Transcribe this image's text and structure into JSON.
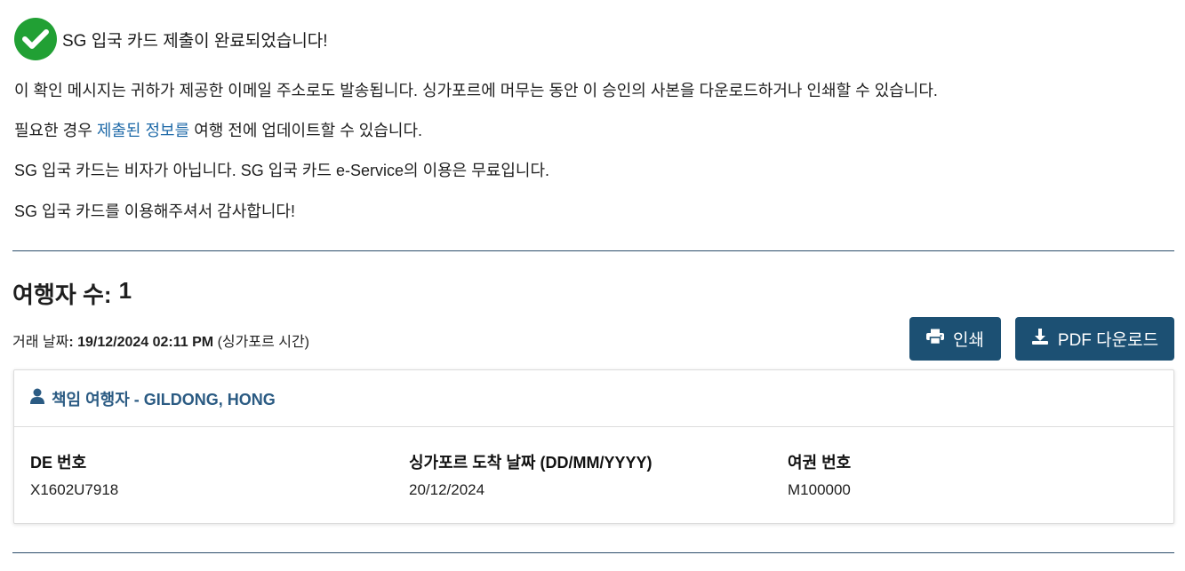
{
  "success": {
    "message": "SG 입국 카드 제출이 완료되었습니다!",
    "icon": "check-circle-icon",
    "color": "#21a034"
  },
  "info": {
    "line1": "이 확인 메시지는 귀하가 제공한 이메일 주소로도 발송됩니다. 싱가포르에 머무는 동안 이 승인의 사본을 다운로드하거나 인쇄할 수 있습니다.",
    "line2_prefix": "필요한 경우 ",
    "line2_link": "제출된 정보를",
    "line2_suffix": " 여행 전에 업데이트할 수 있습니다.",
    "line3": "SG 입국 카드는 비자가 아닙니다. SG 입국 카드 e-Service의 이용은 무료입니다.",
    "line4": "SG 입국 카드를 이용해주셔서 감사합니다!"
  },
  "travellers": {
    "count_label": "여행자 수:",
    "count_value": "1"
  },
  "transaction": {
    "label": "거래 날짜",
    "separator": ": ",
    "datetime": "19/12/2024 02:11 PM",
    "timezone": "(싱가포르 시간)"
  },
  "actions": {
    "print_label": "인쇄",
    "print_icon": "printer-icon",
    "pdf_label": "PDF 다운로드",
    "pdf_icon": "download-icon",
    "button_color": "#1c5073"
  },
  "card": {
    "header": "책임 여행자 - GILDONG, HONG",
    "header_icon": "user-icon",
    "fields": [
      {
        "label": "DE 번호",
        "value": "X1602U7918"
      },
      {
        "label": "싱가포르 도착 날짜 (DD/MM/YYYY)",
        "value": "20/12/2024"
      },
      {
        "label": "여권 번호",
        "value": "M100000"
      }
    ]
  }
}
